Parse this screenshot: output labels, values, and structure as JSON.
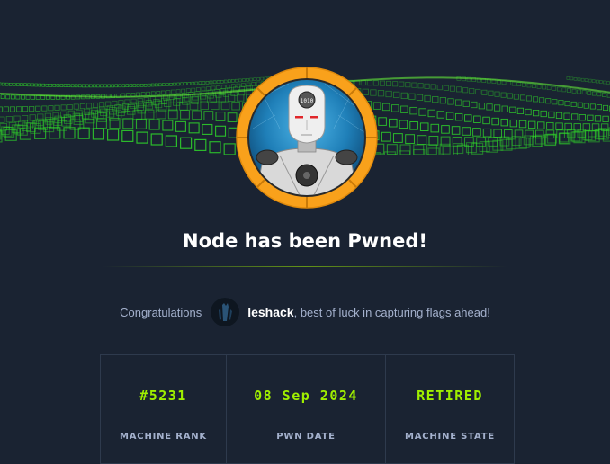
{
  "machine": {
    "name": "Node",
    "title": "Node has been Pwned!",
    "avatar_icon": "robot-avatar-icon"
  },
  "congrats": {
    "prefix": "Congratulations",
    "username": "leshack",
    "suffix": ", best of luck in capturing flags ahead!"
  },
  "stats": [
    {
      "value": "#5231",
      "label": "MACHINE RANK"
    },
    {
      "value": "08 Sep 2024",
      "label": "PWN DATE"
    },
    {
      "value": "RETIRED",
      "label": "MACHINE STATE"
    }
  ],
  "colors": {
    "accent": "#9fef00",
    "background": "#1a2332",
    "badge_ring": "#f9a11b",
    "text_muted": "#a4b1cd"
  }
}
